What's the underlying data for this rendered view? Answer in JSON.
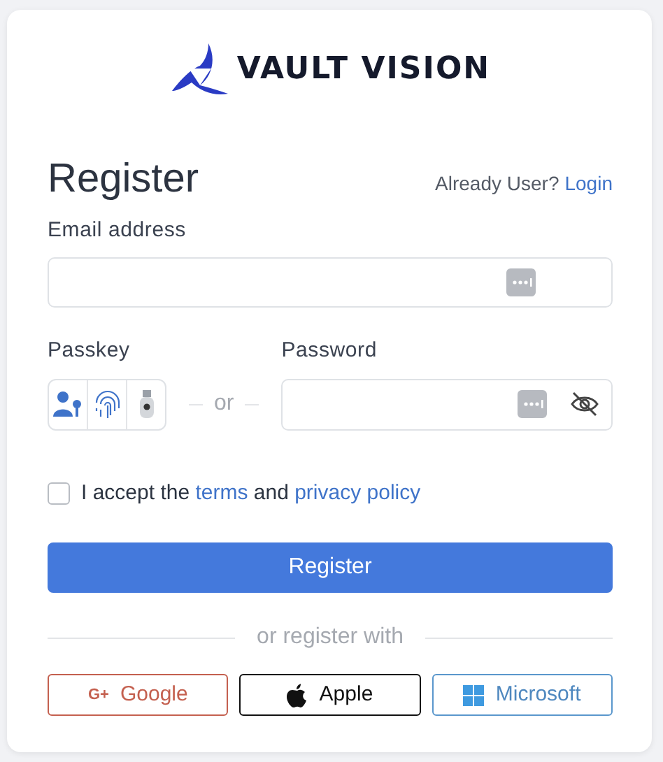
{
  "logo": {
    "text": "VAULT VISION"
  },
  "title": "Register",
  "login_prompt": {
    "text": "Already User?",
    "link": "Login"
  },
  "email": {
    "label": "Email address"
  },
  "passkey": {
    "label": "Passkey"
  },
  "separator": "or",
  "password": {
    "label": "Password"
  },
  "consent": {
    "checked": false,
    "parts": [
      {
        "kind": "text",
        "text": "I accept the "
      },
      {
        "kind": "link",
        "text": "terms"
      },
      {
        "kind": "text",
        "text": " and "
      },
      {
        "kind": "link",
        "text": "privacy policy"
      }
    ]
  },
  "submit": "Register",
  "divider": "or register with",
  "social": [
    {
      "kind": "google",
      "label": "Google",
      "glyph": "G+",
      "color": "#c4604f"
    },
    {
      "kind": "apple",
      "label": "Apple",
      "color": "#111111"
    },
    {
      "kind": "microsoft",
      "label": "Microsoft",
      "color": "#5a97cc"
    }
  ]
}
